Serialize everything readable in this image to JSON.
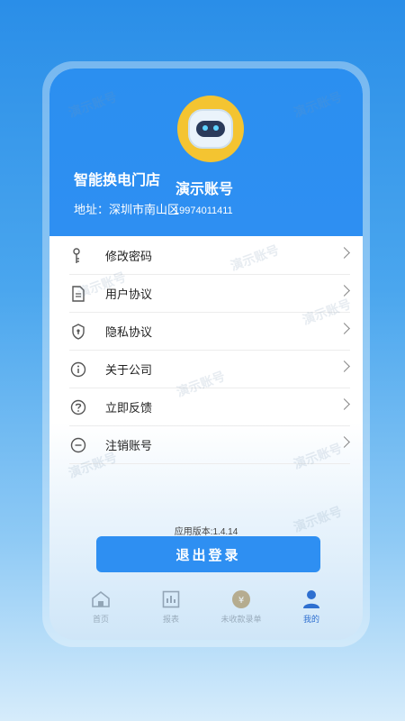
{
  "profile": {
    "shop_name": "智能换电门店",
    "account_name": "演示账号",
    "address": "地址：深圳市南山区",
    "phone": "19974011411"
  },
  "menu": [
    {
      "label": "修改密码",
      "icon": "key-icon"
    },
    {
      "label": "用户协议",
      "icon": "document-icon"
    },
    {
      "label": "隐私协议",
      "icon": "shield-icon"
    },
    {
      "label": "关于公司",
      "icon": "info-icon"
    },
    {
      "label": "立即反馈",
      "icon": "question-icon"
    },
    {
      "label": "注销账号",
      "icon": "minus-circle-icon"
    }
  ],
  "version": "应用版本:1.4.14",
  "logout_label": "退出登录",
  "tabs": [
    {
      "label": "首页",
      "icon": "home-icon"
    },
    {
      "label": "报表",
      "icon": "report-icon"
    },
    {
      "label": "未收款录单",
      "icon": "receipt-icon"
    },
    {
      "label": "我的",
      "icon": "user-icon"
    }
  ],
  "watermark_text": "演示账号",
  "colors": {
    "accent": "#2e8ff2",
    "avatar_bg": "#f4c431"
  }
}
